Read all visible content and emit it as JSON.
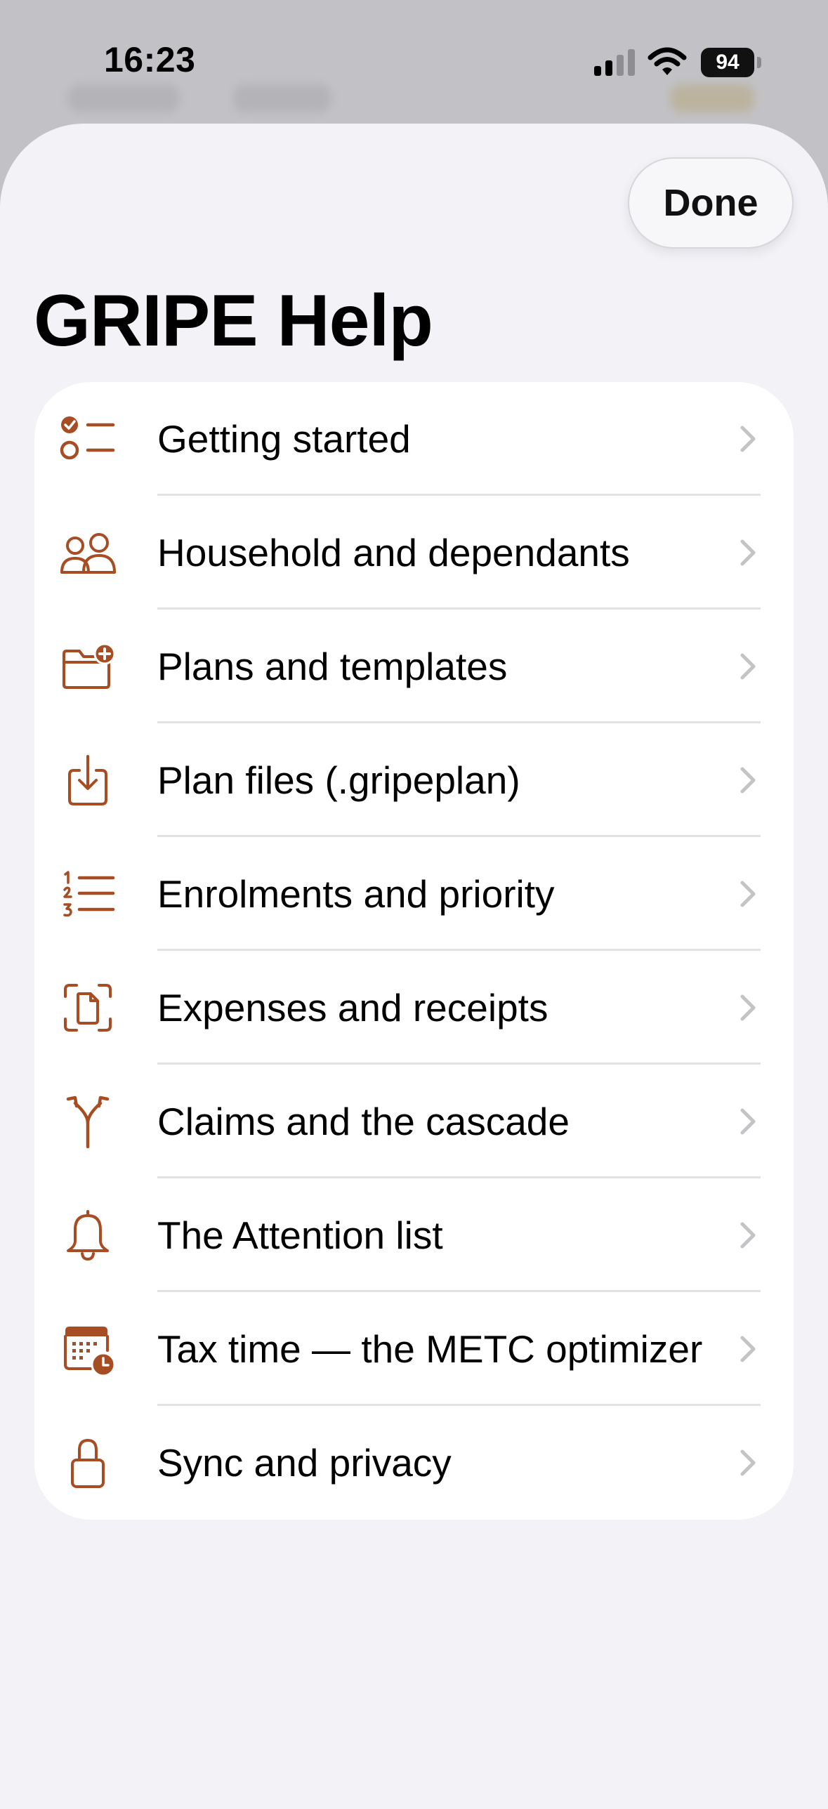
{
  "status_bar": {
    "time": "16:23",
    "battery": "94",
    "icons": [
      "cellular-signal-icon",
      "wifi-icon",
      "battery-icon"
    ]
  },
  "sheet": {
    "done_label": "Done",
    "title": "GRIPE Help"
  },
  "colors": {
    "accent": "#a64d24",
    "sheet_background": "#f2f2f7",
    "list_background": "#ffffff",
    "chevron": "#c4c4c7"
  },
  "help_items": [
    {
      "label": "Getting started",
      "icon": "checklist-icon"
    },
    {
      "label": "Household and dependants",
      "icon": "people-icon"
    },
    {
      "label": "Plans and templates",
      "icon": "folder-add-icon"
    },
    {
      "label": "Plan files (.gripeplan)",
      "icon": "download-tray-icon"
    },
    {
      "label": "Enrolments and priority",
      "icon": "numbered-list-icon"
    },
    {
      "label": "Expenses and receipts",
      "icon": "document-scan-icon"
    },
    {
      "label": "Claims and the cascade",
      "icon": "branch-split-icon"
    },
    {
      "label": "The Attention list",
      "icon": "bell-icon"
    },
    {
      "label": "Tax time — the METC optimizer",
      "icon": "calendar-clock-icon"
    },
    {
      "label": "Sync and privacy",
      "icon": "lock-icon"
    }
  ]
}
